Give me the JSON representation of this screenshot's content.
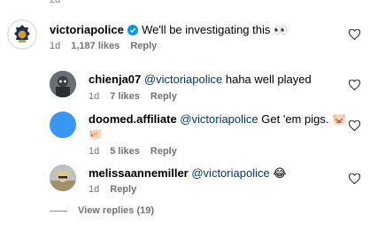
{
  "top_fragment": "2d",
  "heart_color": "#262626",
  "accent_verified": "#0095f6",
  "mention_color": "#00376b",
  "comments": [
    {
      "username": "victoriapolice",
      "verified": true,
      "text": "We'll be investigating this 👀",
      "time": "1d",
      "likes": "1,187 likes",
      "reply_label": "Reply",
      "avatar": "police-badge-avatar"
    },
    {
      "username": "chienja07",
      "mention": "@victoriapolice",
      "text": "haha well played",
      "time": "1d",
      "likes": "7 likes",
      "reply_label": "Reply",
      "avatar": "photo-avatar"
    },
    {
      "username": "doomed.affiliate",
      "mention": "@victoriapolice",
      "text": "Get 'em pigs. 🐷",
      "text_line2": "🐖",
      "time": "1d",
      "likes": "5 likes",
      "reply_label": "Reply",
      "avatar": "blue-circle-avatar"
    },
    {
      "username": "melissaannemiller",
      "mention": "@victoriapolice",
      "text": "😂",
      "time": "1d",
      "reply_label": "Reply",
      "avatar": "photo-avatar"
    }
  ],
  "view_replies": "View replies (19)"
}
